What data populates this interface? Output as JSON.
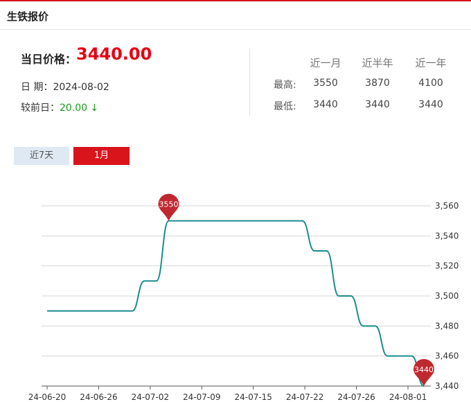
{
  "header": {
    "title": "生铁报价"
  },
  "summary": {
    "price_label": "当日价格：",
    "price": "3440.00",
    "date_label": "日 期：",
    "date": "2024-08-02",
    "change_label": "较前日：",
    "change": "20.00",
    "change_arrow": "↓"
  },
  "stats": {
    "headers": [
      "近一月",
      "近半年",
      "近一年"
    ],
    "high_label": "最高:",
    "low_label": "最低:",
    "high": [
      "3550",
      "3870",
      "4100"
    ],
    "low": [
      "3440",
      "3440",
      "3440"
    ]
  },
  "tabs": {
    "week": "近7天",
    "month": "1月"
  },
  "colors": {
    "accent": "#d9141b",
    "line": "#1a8c8c",
    "down": "#1a9c1a",
    "marker": "#c0282f"
  },
  "chart_data": {
    "type": "line",
    "ylim": [
      3440,
      3560
    ],
    "yticks": [
      "3,440",
      "3,460",
      "3,480",
      "3,500",
      "3,520",
      "3,540",
      "3,560"
    ],
    "ytick_values": [
      3440,
      3460,
      3480,
      3500,
      3520,
      3540,
      3560
    ],
    "x_tick_labels": [
      "24-06-20",
      "24-06-26",
      "24-07-02",
      "24-07-09",
      "24-07-15",
      "24-07-22",
      "24-07-26",
      "24-08-01"
    ],
    "x": [
      "06-20",
      "06-21",
      "06-24",
      "06-25",
      "06-26",
      "06-27",
      "06-28",
      "07-01",
      "07-02",
      "07-03",
      "07-04",
      "07-05",
      "07-08",
      "07-09",
      "07-10",
      "07-11",
      "07-12",
      "07-15",
      "07-16",
      "07-17",
      "07-18",
      "07-19",
      "07-22",
      "07-23",
      "07-24",
      "07-25",
      "07-26",
      "07-29",
      "07-30",
      "07-31",
      "08-01",
      "08-02"
    ],
    "values": [
      3490,
      3490,
      3490,
      3490,
      3490,
      3490,
      3490,
      3490,
      3510,
      3510,
      3550,
      3550,
      3550,
      3550,
      3550,
      3550,
      3550,
      3550,
      3550,
      3550,
      3550,
      3550,
      3530,
      3530,
      3500,
      3500,
      3480,
      3480,
      3460,
      3460,
      3460,
      3440
    ],
    "markers": [
      {
        "label": "3550",
        "value": 3550,
        "index": 10
      },
      {
        "label": "3440",
        "value": 3440,
        "index": 31
      }
    ]
  }
}
